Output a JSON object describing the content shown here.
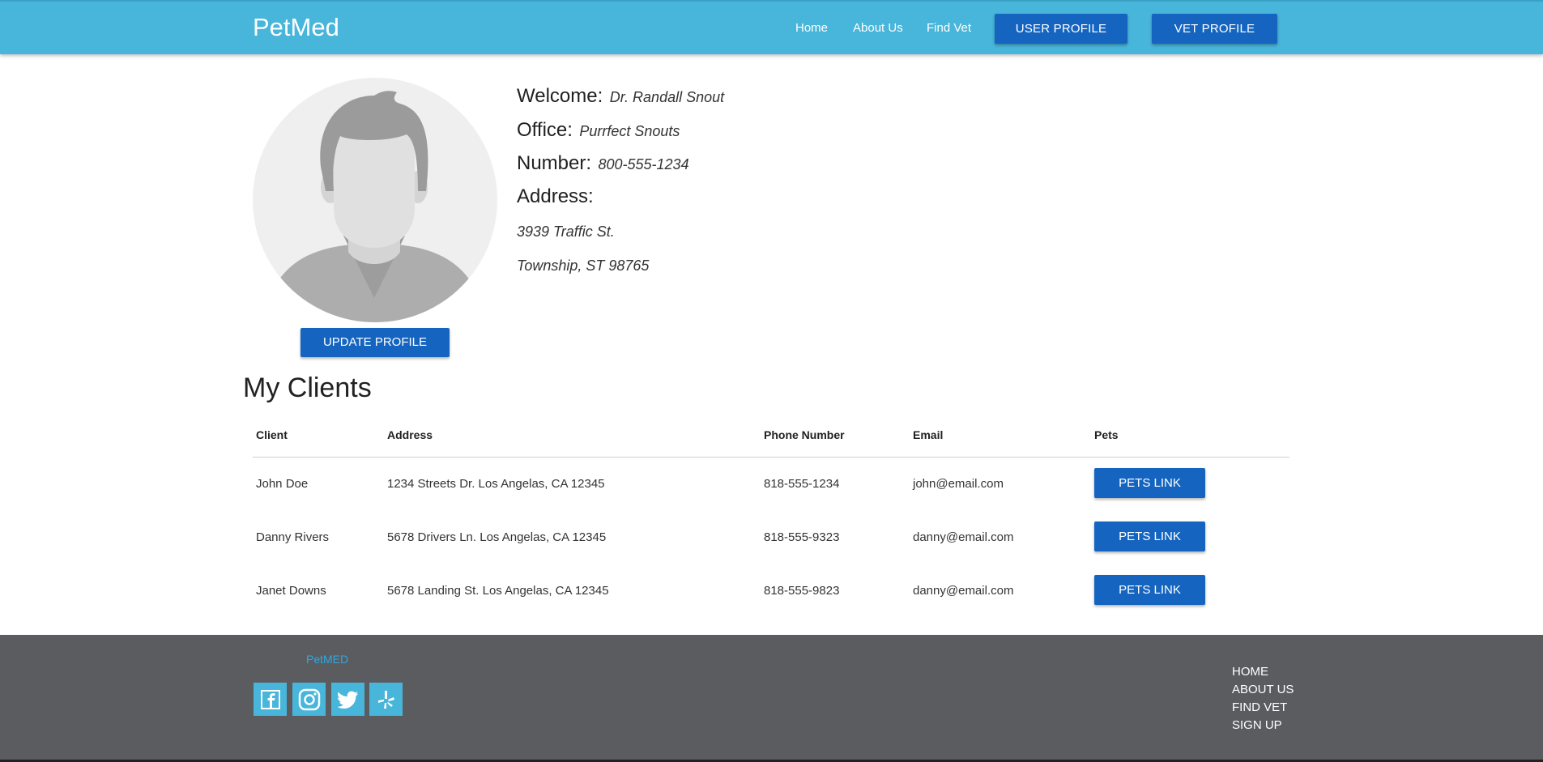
{
  "nav": {
    "brand": "PetMed",
    "links": [
      "Home",
      "About Us",
      "Find Vet"
    ],
    "user_profile_label": "USER PROFILE",
    "vet_profile_label": "VET PROFILE"
  },
  "profile": {
    "update_label": "UPDATE PROFILE",
    "welcome_label": "Welcome:",
    "welcome_value": "Dr. Randall Snout",
    "office_label": "Office:",
    "office_value": "Purrfect Snouts",
    "number_label": "Number:",
    "number_value": "800-555-1234",
    "address_label": "Address:",
    "address_line1": "3939 Traffic St.",
    "address_line2": "Township, ST 98765"
  },
  "clients": {
    "title": "My Clients",
    "headers": [
      "Client",
      "Address",
      "Phone Number",
      "Email",
      "Pets"
    ],
    "rows": [
      {
        "client": "John Doe",
        "address": "1234 Streets Dr. Los Angelas, CA 12345",
        "phone": "818-555-1234",
        "email": "john@email.com",
        "pets": "PETS LINK"
      },
      {
        "client": "Danny Rivers",
        "address": "5678 Drivers Ln. Los Angelas, CA 12345",
        "phone": "818-555-9323",
        "email": "danny@email.com",
        "pets": "PETS LINK"
      },
      {
        "client": "Janet Downs",
        "address": "5678 Landing St. Los Angelas, CA 12345",
        "phone": "818-555-9823",
        "email": "danny@email.com",
        "pets": "PETS LINK"
      }
    ]
  },
  "footer": {
    "brand": "PetMED",
    "social_icons": [
      "facebook-icon",
      "instagram-icon",
      "twitter-icon",
      "yelp-icon"
    ],
    "links": [
      "HOME",
      "ABOUT US",
      "FIND VET",
      "SIGN UP"
    ]
  },
  "colors": {
    "navbar": "#48b5da",
    "button": "#1565c0",
    "footer": "#5b5c60",
    "footer_brand": "#2fa8e0"
  }
}
